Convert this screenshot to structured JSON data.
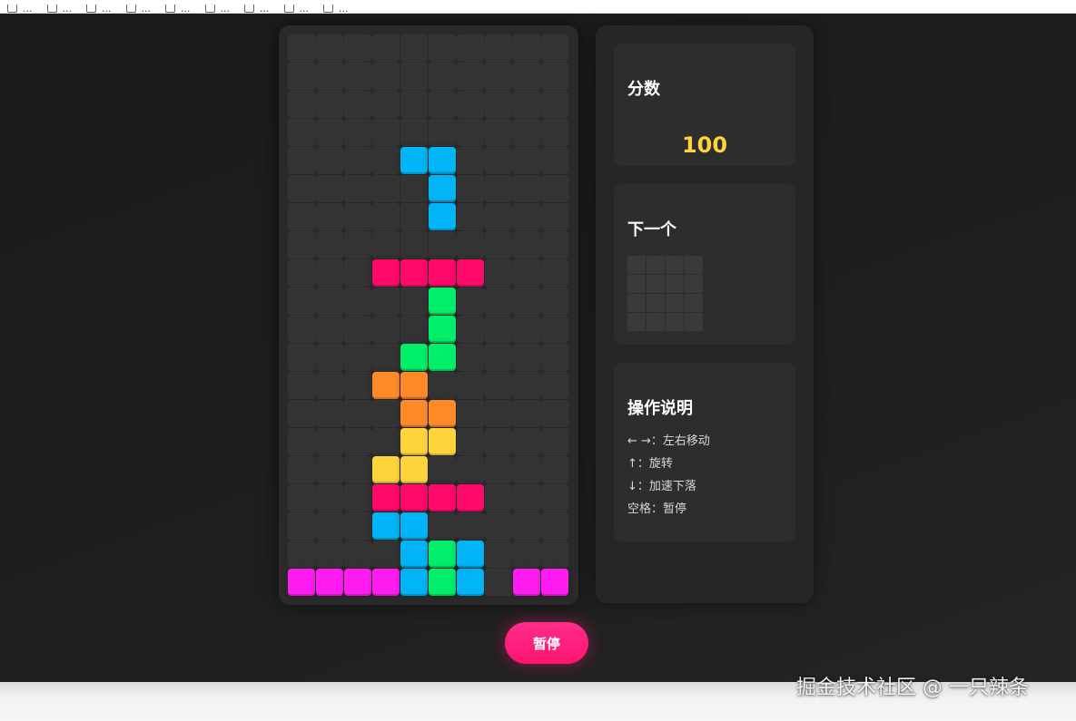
{
  "bookmarks": [
    {
      "label": "...",
      "icon": "folder-icon"
    },
    {
      "label": "...",
      "icon": "folder-icon"
    },
    {
      "label": "...",
      "icon": "folder-icon"
    },
    {
      "label": "...",
      "icon": "folder-icon"
    },
    {
      "label": "...",
      "icon": "folder-icon"
    },
    {
      "label": "...",
      "icon": "folder-icon"
    },
    {
      "label": "...",
      "icon": "folder-icon"
    },
    {
      "label": "...",
      "icon": "folder-icon"
    },
    {
      "label": "...",
      "icon": "folder-icon"
    }
  ],
  "colors": {
    "I": "#00b4f5",
    "Z": "#ff0a6a",
    "S": "#00ee6a",
    "L": "#ff8a2a",
    "O": "#ffd43b",
    "T": "#ff1cf0",
    "empty": "#333333",
    "accent": "#ff1470",
    "score": "#ffd23f"
  },
  "board": {
    "cols": 10,
    "rows": 20,
    "grid": [
      "..........",
      "..........",
      "..........",
      "..........",
      "....II....",
      ".....I....",
      ".....I....",
      "..........",
      "...ZZZZ...",
      ".....S....",
      ".....S....",
      "....SS....",
      "...LL.....",
      "....LL....",
      "....OO....",
      "...OO.....",
      "...ZZZZ...",
      "...II.....",
      "....ISI...",
      "TTTTISI.TT"
    ]
  },
  "score": {
    "title": "分数",
    "value": "100"
  },
  "next": {
    "title": "下一个",
    "grid": [
      "....",
      "....",
      "....",
      "...."
    ]
  },
  "controls": {
    "title": "操作说明",
    "lines": [
      "← →：左右移动",
      "↑：旋转",
      "↓：加速下落",
      "空格：暂停"
    ]
  },
  "pause_button": {
    "label": "暂停"
  },
  "watermark": "掘金技术社区 @ 一只辣条"
}
